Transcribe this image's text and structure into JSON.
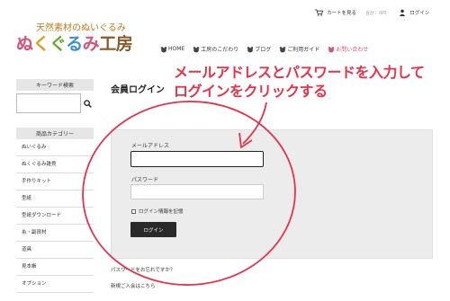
{
  "header": {
    "logo_subtitle": "天然素材のぬいぐるみ",
    "logo_title": [
      "ぬ",
      "く",
      "ぐ",
      "る",
      "み",
      "工房"
    ],
    "cart_label": "カートを見る",
    "total_label": "合計：0円",
    "login_label": "ログイン"
  },
  "nav": {
    "items": [
      {
        "label": "HOME"
      },
      {
        "label": "工房のこだわり"
      },
      {
        "label": "ブログ"
      },
      {
        "label": "ご利用ガイド"
      },
      {
        "label": "お問い合わせ"
      }
    ]
  },
  "sidebar": {
    "search_heading": "キーワード検索",
    "category_heading": "商品カテゴリー",
    "categories": [
      {
        "label": "ぬいぐるみ"
      },
      {
        "label": "ぬくぐるみ雑貨"
      },
      {
        "label": "手作りキット"
      },
      {
        "label": "型紙"
      },
      {
        "label": "型紙ダウンロード"
      },
      {
        "label": "糸・副資材"
      },
      {
        "label": "道具"
      },
      {
        "label": "見本帳"
      },
      {
        "label": "オプション"
      }
    ]
  },
  "main": {
    "page_title": "会員ログイン",
    "email_label": "メールアドレス",
    "email_value": "",
    "password_label": "パスワード",
    "password_value": "",
    "remember_label": "ログイン情報を記憶",
    "login_button": "ログイン",
    "forgot_link": "パスワードをお忘れですか？",
    "register_link": "新規ご入会はこちら"
  },
  "annotation": {
    "line1": "メールアドレスとパスワードを入力して",
    "line2": "ログインをクリックする",
    "color": "#e8324c"
  },
  "colors": {
    "accent_pink": "#d9527a",
    "button_dark": "#2a2a2a",
    "panel_bg": "#ececec"
  }
}
